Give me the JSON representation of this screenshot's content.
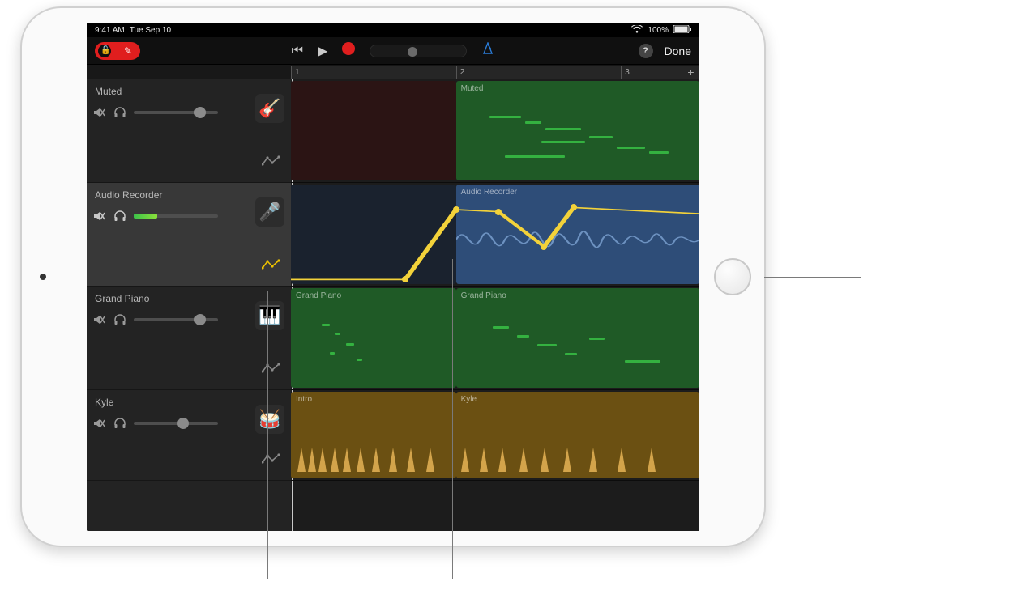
{
  "statusbar": {
    "time": "9:41 AM",
    "date": "Tue Sep 10",
    "battery_pct": "100%"
  },
  "toolbar": {
    "done_label": "Done",
    "help_glyph": "?"
  },
  "ruler": {
    "bars": [
      "1",
      "2",
      "3"
    ],
    "add_glyph": "+"
  },
  "tracks": [
    {
      "name": "Muted",
      "instrument": "bass",
      "volume_pct": 72,
      "selected": false,
      "automation_active": false,
      "regions": [
        {
          "label": "",
          "start_pct": 0,
          "width_pct": 40.4,
          "color": "#2b1414",
          "type": "midi"
        },
        {
          "label": "Muted",
          "start_pct": 40.4,
          "width_pct": 59.6,
          "color": "#1f5a26",
          "type": "midi"
        }
      ]
    },
    {
      "name": "Audio Recorder",
      "instrument": "mic",
      "volume_pct": 28,
      "has_level_meter": true,
      "selected": true,
      "automation_active": true,
      "regions": [
        {
          "label": "",
          "start_pct": 0,
          "width_pct": 40.4,
          "color": "#1a222e",
          "type": "audio"
        },
        {
          "label": "Audio Recorder",
          "start_pct": 40.4,
          "width_pct": 59.6,
          "color": "#2e4d78",
          "type": "audio"
        }
      ],
      "automation_points": [
        {
          "x_pct": 0,
          "y_pct": 94
        },
        {
          "x_pct": 28.0,
          "y_pct": 94
        },
        {
          "x_pct": 40.4,
          "y_pct": 26
        },
        {
          "x_pct": 50.8,
          "y_pct": 28
        },
        {
          "x_pct": 62.0,
          "y_pct": 62
        },
        {
          "x_pct": 69.2,
          "y_pct": 24
        },
        {
          "x_pct": 100,
          "y_pct": 30
        }
      ]
    },
    {
      "name": "Grand Piano",
      "instrument": "piano",
      "volume_pct": 72,
      "selected": false,
      "automation_active": false,
      "regions": [
        {
          "label": "Grand Piano",
          "start_pct": 0,
          "width_pct": 40.4,
          "color": "#1f5a26",
          "type": "midi"
        },
        {
          "label": "Grand Piano",
          "start_pct": 40.4,
          "width_pct": 59.6,
          "color": "#1f5a26",
          "type": "midi"
        }
      ]
    },
    {
      "name": "Kyle",
      "instrument": "drums",
      "volume_pct": 52,
      "selected": false,
      "automation_active": false,
      "regions": [
        {
          "label": "Intro",
          "start_pct": 0,
          "width_pct": 40.4,
          "color": "#6b5012",
          "type": "drums"
        },
        {
          "label": "Kyle",
          "start_pct": 40.4,
          "width_pct": 59.6,
          "color": "#6b5012",
          "type": "drums"
        }
      ]
    }
  ],
  "colors": {
    "automation_line": "#f3d23a",
    "playhead": "#d0d0d0"
  }
}
